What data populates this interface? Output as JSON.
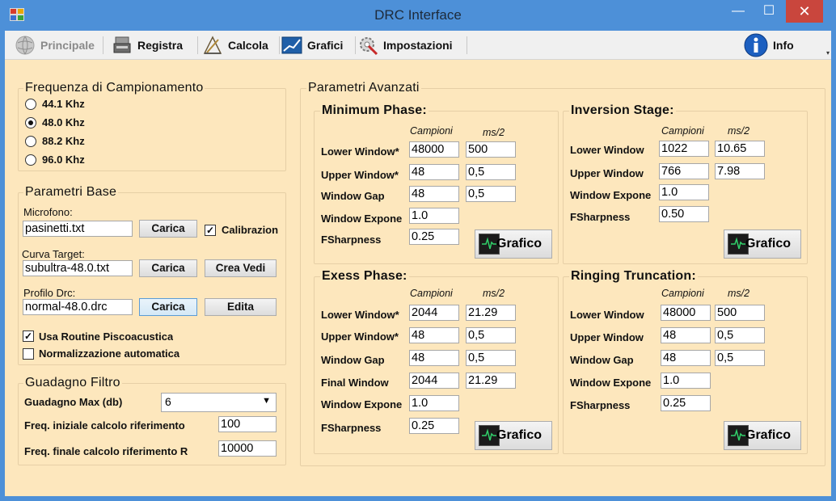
{
  "window": {
    "title": "DRC Interface",
    "minimize": "—",
    "maximize": "☐",
    "close": "✕"
  },
  "toolbar": {
    "principale": "Principale",
    "registra": "Registra",
    "calcola": "Calcola",
    "grafici": "Grafici",
    "impostazioni": "Impostazioni",
    "info": "Info"
  },
  "frequenza": {
    "title": "Frequenza di Campionamento",
    "options": [
      "44.1 Khz",
      "48.0 Khz",
      "88.2 Khz",
      "96.0 Khz"
    ],
    "selected": "48.0 Khz"
  },
  "base": {
    "title": "Parametri Base",
    "microfono_label": "Microfono:",
    "microfono_value": "pasinetti.txt",
    "carica": "Carica",
    "calibrazione_label": "Calibrazion",
    "calibrazione_checked": true,
    "curva_label": "Curva Target:",
    "curva_value": "subultra-48.0.txt",
    "crea_vedi": "Crea Vedi",
    "profilo_label": "Profilo Drc:",
    "profilo_value": "normal-48.0.drc",
    "edita": "Edita",
    "psico_label": "Usa Routine Piscoacustica",
    "psico_checked": true,
    "norm_label": "Normalizzazione automatica",
    "norm_checked": false
  },
  "guadagno": {
    "title": "Guadagno Filtro",
    "max_label": "Guadagno Max (db)",
    "max_value": "6",
    "freq_ini_label": "Freq. iniziale calcolo riferimento",
    "freq_ini_value": "100",
    "freq_fin_label": "Freq. finale calcolo riferimento R",
    "freq_fin_value": "10000"
  },
  "avanzati": {
    "title": "Parametri Avanzati",
    "col_campioni": "Campioni",
    "col_ms": "ms/2",
    "grafico": "Grafico",
    "minimum": {
      "title": "Minimum Phase:",
      "lower_label": "Lower Window*",
      "lower_c": "48000",
      "lower_ms": "500",
      "upper_label": "Upper Window*",
      "upper_c": "48",
      "upper_ms": "0,5",
      "gap_label": "Window Gap",
      "gap_c": "48",
      "gap_ms": "0,5",
      "exp_label": "Window Expone",
      "exp_value": "1.0",
      "fsharp_label": "FSharpness",
      "fsharp_value": "0.25"
    },
    "inversion": {
      "title": "Inversion Stage:",
      "lower_label": "Lower Window",
      "lower_c": "1022",
      "lower_ms": "10.65",
      "upper_label": "Upper Window",
      "upper_c": "766",
      "upper_ms": "7.98",
      "exp_label": "Window Expone",
      "exp_value": "1.0",
      "fsharp_label": "FSharpness",
      "fsharp_value": "0.50"
    },
    "exess": {
      "title": "Exess Phase:",
      "lower_label": "Lower Window*",
      "lower_c": "2044",
      "lower_ms": "21.29",
      "upper_label": "Upper Window*",
      "upper_c": "48",
      "upper_ms": "0,5",
      "gap_label": "Window Gap",
      "gap_c": "48",
      "gap_ms": "0,5",
      "final_label": "Final Window",
      "final_c": "2044",
      "final_ms": "21.29",
      "exp_label": "Window Expone",
      "exp_value": "1.0",
      "fsharp_label": "FSharpness",
      "fsharp_value": "0.25"
    },
    "ringing": {
      "title": "Ringing Truncation:",
      "lower_label": "Lower Window",
      "lower_c": "48000",
      "lower_ms": "500",
      "upper_label": "Upper Window",
      "upper_c": "48",
      "upper_ms": "0,5",
      "gap_label": "Window Gap",
      "gap_c": "48",
      "gap_ms": "0,5",
      "exp_label": "Window Expone",
      "exp_value": "1.0",
      "fsharp_label": "FSharpness",
      "fsharp_value": "0.25"
    }
  }
}
